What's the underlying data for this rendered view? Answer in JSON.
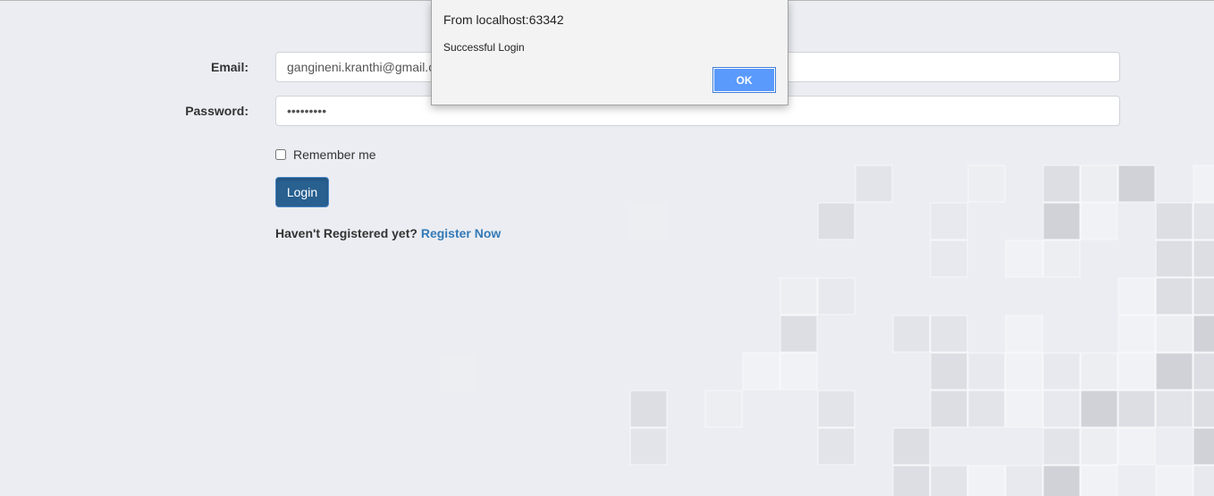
{
  "form": {
    "email_label": "Email:",
    "email_value": "gangineni.kranthi@gmail.com",
    "password_label": "Password:",
    "password_value": "•••••••••",
    "remember_label": "Remember me",
    "remember_checked": false,
    "login_label": "Login",
    "register_prompt": "Haven't Registered yet?",
    "register_link": "Register Now"
  },
  "dialog": {
    "title": "From localhost:63342",
    "message": "Successful Login",
    "ok_label": "OK"
  },
  "colors": {
    "background": "#ebedf2",
    "primary_button": "#286090",
    "link": "#337ab7",
    "dialog_ok": "#5a9afc"
  }
}
